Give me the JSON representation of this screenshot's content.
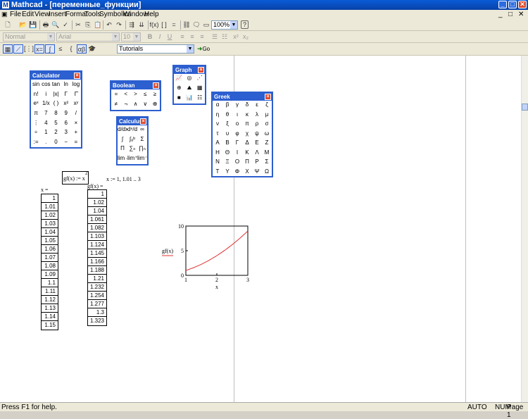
{
  "window": {
    "title": "Mathcad - [переменные_функции]",
    "min": "_",
    "max": "□",
    "close": "✕"
  },
  "doc_ctrl": {
    "min": "_",
    "max": "□",
    "close": "✕"
  },
  "menu": [
    "File",
    "Edit",
    "View",
    "Insert",
    "Format",
    "Tools",
    "Symbolics",
    "Window",
    "Help"
  ],
  "toolbar": {
    "zoom": "100%",
    "help": "?"
  },
  "format": {
    "style": "Normal",
    "font": "Arial",
    "size": "10"
  },
  "resources": {
    "selected": "Tutorials",
    "go_label": "Go"
  },
  "palettes": {
    "calculator": {
      "title": "Calculator",
      "buttons": [
        "sin",
        "cos",
        "tan",
        "ln",
        "log",
        "n!",
        "i",
        "|x|",
        "Γ",
        "Γ̄",
        "eˣ",
        "1/x",
        "( )",
        "x²",
        "xʸ",
        "π",
        "7",
        "8",
        "9",
        "/",
        "⋮",
        "4",
        "5",
        "6",
        "×",
        "÷",
        "1",
        "2",
        "3",
        "+",
        ":=",
        ".",
        "0",
        "−",
        "="
      ]
    },
    "boolean": {
      "title": "Boolean",
      "buttons": [
        "=",
        "<",
        ">",
        "≤",
        "≥",
        "≠",
        "¬",
        "∧",
        "∨",
        "⊕"
      ]
    },
    "graph": {
      "title": "Graph",
      "buttons": [
        "📈",
        "◎",
        "⋰",
        "⊕",
        "⛰",
        "▦",
        "■",
        "📊",
        "☷"
      ]
    },
    "calculus": {
      "title": "Calculus",
      "buttons": [
        "d/dx",
        "dⁿ/dx",
        "∞",
        "∫",
        "∫ₐᵇ",
        "Σ",
        "Π",
        "∑ₙ",
        "∏ₙ",
        "lim→",
        "lim⁺",
        "lim⁻"
      ]
    },
    "greek": {
      "title": "Greek",
      "buttons": [
        "α",
        "β",
        "γ",
        "δ",
        "ε",
        "ζ",
        "η",
        "θ",
        "ι",
        "κ",
        "λ",
        "μ",
        "ν",
        "ξ",
        "ο",
        "π",
        "ρ",
        "σ",
        "τ",
        "υ",
        "φ",
        "χ",
        "ψ",
        "ω",
        "Α",
        "Β",
        "Γ",
        "Δ",
        "Ε",
        "Ζ",
        "Η",
        "Θ",
        "Ι",
        "Κ",
        "Λ",
        "Μ",
        "Ν",
        "Ξ",
        "Ο",
        "Π",
        "Ρ",
        "Σ",
        "Τ",
        "Υ",
        "Φ",
        "Χ",
        "Ψ",
        "Ω"
      ]
    }
  },
  "worksheet": {
    "func_def": "gf(x) := x",
    "func_exp": "2",
    "range_def": "x := 1, 1.01 .. 3",
    "x_label": "x =",
    "gf_label": "gf(x) =",
    "x_values": [
      "1",
      "1.01",
      "1.02",
      "1.03",
      "1.04",
      "1.05",
      "1.06",
      "1.07",
      "1.08",
      "1.09",
      "1.1",
      "1.11",
      "1.12",
      "1.13",
      "1.14",
      "1.15"
    ],
    "gf_values": [
      "1",
      "1.02",
      "1.04",
      "1.061",
      "1.082",
      "1.103",
      "1.124",
      "1.145",
      "1.166",
      "1.188",
      "1.21",
      "1.232",
      "1.254",
      "1.277",
      "1.3",
      "1.323"
    ]
  },
  "chart_data": {
    "type": "line",
    "series": [
      {
        "name": "gf(x)",
        "x_range": [
          1,
          3
        ],
        "function": "x^2",
        "color": "#e03030"
      }
    ],
    "xlabel": "x",
    "ylabel": "gf(x)",
    "xlim": [
      1,
      3
    ],
    "ylim": [
      0,
      10
    ],
    "x_ticks": [
      "1",
      "2",
      "3"
    ],
    "y_ticks": [
      "0",
      "5",
      "10"
    ]
  },
  "status": {
    "help": "Press F1 for help.",
    "mode": "AUTO",
    "num": "NUM",
    "page": "Page 1"
  }
}
